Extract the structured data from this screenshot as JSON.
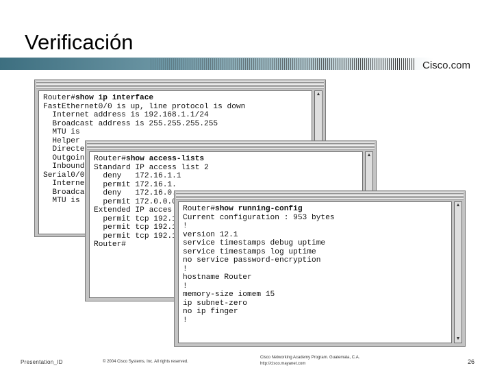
{
  "slide": {
    "title": "Verificación",
    "brand": "Cisco.com"
  },
  "windows": [
    {
      "name": "show-ip-interface",
      "command": "Router#show ip interface",
      "prompt_prefix": "Router#",
      "command_text": "show ip interface",
      "lines": [
        "FastEthernet0/0 is up, line protocol is down",
        "  Internet address is 192.168.1.1/24",
        "  Broadcast address is 255.255.255.255",
        "  MTU is",
        "  Helper",
        "  Directe",
        "  Outgoin",
        "  Inbound",
        "Serial0/0",
        "  Interne",
        "  Broadca",
        "  MTU is"
      ]
    },
    {
      "name": "show-access-lists",
      "prompt_prefix": "Router#",
      "command_text": "show access-lists",
      "lines": [
        "Standard IP access list 2",
        "  deny   172.16.1.1",
        "  permit 172.16.1.",
        "  deny   172.16.0.",
        "  permit 172.0.0.0",
        "Extended IP acces",
        "  permit tcp 192.1",
        "  permit tcp 192.1",
        "  permit tcp 192.1",
        "Router#"
      ]
    },
    {
      "name": "show-running-config",
      "prompt_prefix": "Router#",
      "command_text": "show running-config",
      "lines": [
        "Current configuration : 953 bytes",
        "!",
        "version 12.1",
        "service timestamps debug uptime",
        "service timestamps log uptime",
        "no service password-encryption",
        "!",
        "hostname Router",
        "!",
        "memory-size iomem 15",
        "ip subnet-zero",
        "no ip finger",
        "!"
      ]
    }
  ],
  "footer": {
    "presentation_id": "Presentation_ID",
    "copyright": "© 2004 Cisco Systems, Inc. All rights reserved.",
    "academy_line1": "Cisco Networking Academy Program. Guatemala, C.A.",
    "academy_line2": "http://cisco.mayanet.com",
    "page_number": "26"
  },
  "colors": {
    "accent_teal": "#3d6f80",
    "window_gray": "#c4c4c4"
  },
  "icons": {
    "scroll_up": "scroll-up-arrow-icon",
    "scroll_down": "scroll-down-arrow-icon"
  }
}
